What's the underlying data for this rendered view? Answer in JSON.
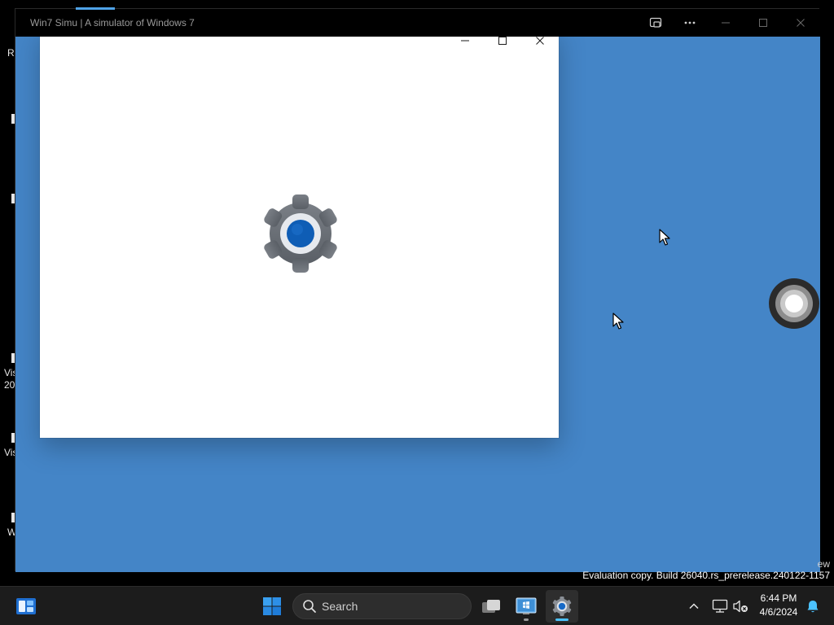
{
  "app_window": {
    "title": "Win7 Simu | A simulator of Windows 7",
    "controls": {
      "cast_icon": "cast-icon",
      "more_icon": "more-icon",
      "minimize_icon": "minimize-icon",
      "maximize_icon": "maximize-icon",
      "close_icon": "close-icon"
    }
  },
  "settings_window": {
    "splash_icon": "gear-icon",
    "controls": {
      "minimize_icon": "minimize-icon",
      "maximize_icon": "maximize-icon",
      "close_icon": "close-icon"
    }
  },
  "desktop": {
    "left_fragments": [
      "Re",
      "Vis",
      "20",
      "Vis",
      "W"
    ],
    "edge_fragment": "ew",
    "watermark": "Evaluation copy. Build 26040.rs_prerelease.240122-1157"
  },
  "taskbar": {
    "search_placeholder": "Search",
    "apps": [
      {
        "name": "widgets",
        "icon": "widgets-icon"
      },
      {
        "name": "start",
        "icon": "windows-logo-icon"
      },
      {
        "name": "task-view",
        "icon": "task-view-icon"
      },
      {
        "name": "win7simu",
        "icon": "win7simu-app-icon",
        "running": true
      },
      {
        "name": "settings",
        "icon": "gear-icon",
        "active": true
      }
    ],
    "tray": {
      "chevron_icon": "chevron-up-icon",
      "network_icon": "network-icon",
      "volume_icon": "volume-muted-icon",
      "notification_icon": "bell-icon"
    },
    "clock": {
      "time": "6:44 PM",
      "date": "4/6/2024"
    }
  },
  "colors": {
    "desktop_blue": "#4485c7",
    "taskbar": "#1c1c1c",
    "accent": "#4cc2ff",
    "settings_gear": "#6e7379",
    "settings_center": "#0f5db5"
  }
}
